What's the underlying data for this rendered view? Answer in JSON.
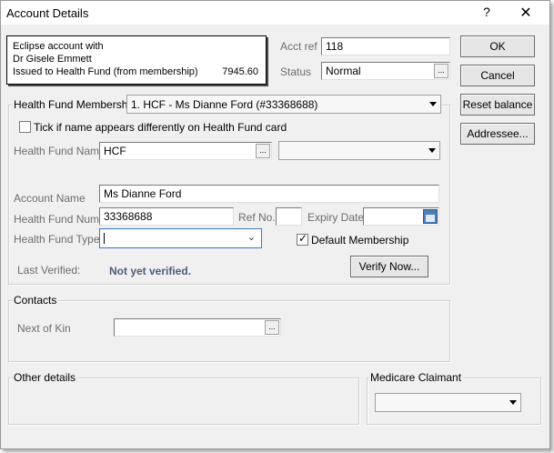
{
  "window": {
    "title": "Account Details",
    "help_glyph": "?",
    "close_glyph": "✕"
  },
  "info": {
    "line1": "Eclipse account with",
    "line2": "Dr Gisele Emmett",
    "line3": "Issued to Health Fund (from membership)",
    "amount": "7945.60"
  },
  "acct": {
    "ref_label": "Acct ref",
    "ref_value": "118",
    "status_label": "Status",
    "status_value": "Normal"
  },
  "buttons": {
    "ok": "OK",
    "cancel": "Cancel",
    "reset_balance": "Reset balance",
    "addressee": "Addressee...",
    "verify_now": "Verify Now..."
  },
  "membership": {
    "label": "Health Fund Membership",
    "selected": "1. HCF - Ms Dianne Ford (#33368688)",
    "tick_label": "Tick if name appears differently on Health Fund card",
    "fund_name_label": "Health Fund Name",
    "fund_name_value": "HCF",
    "fund_name_combo": "",
    "account_name_label": "Account Name",
    "account_name_value": "Ms Dianne Ford",
    "fund_number_label": "Health Fund Number",
    "fund_number_value": "33368688",
    "ref_no_label": "Ref No.",
    "ref_no_value": "",
    "expiry_label": "Expiry Date",
    "expiry_value": "",
    "fund_type_label": "Health Fund Type",
    "fund_type_value": "",
    "default_membership_label": "Default Membership",
    "default_membership_checked": true,
    "last_verified_label": "Last Verified:",
    "last_verified_value": "Not yet verified."
  },
  "contacts": {
    "title": "Contacts",
    "next_of_kin_label": "Next of Kin",
    "next_of_kin_value": ""
  },
  "other": {
    "title": "Other details"
  },
  "medicare": {
    "title": "Medicare Claimant",
    "value": ""
  },
  "icons": {
    "ellipsis": "...",
    "dropdown": "chevron-down-icon",
    "calendar": "calendar-icon"
  }
}
